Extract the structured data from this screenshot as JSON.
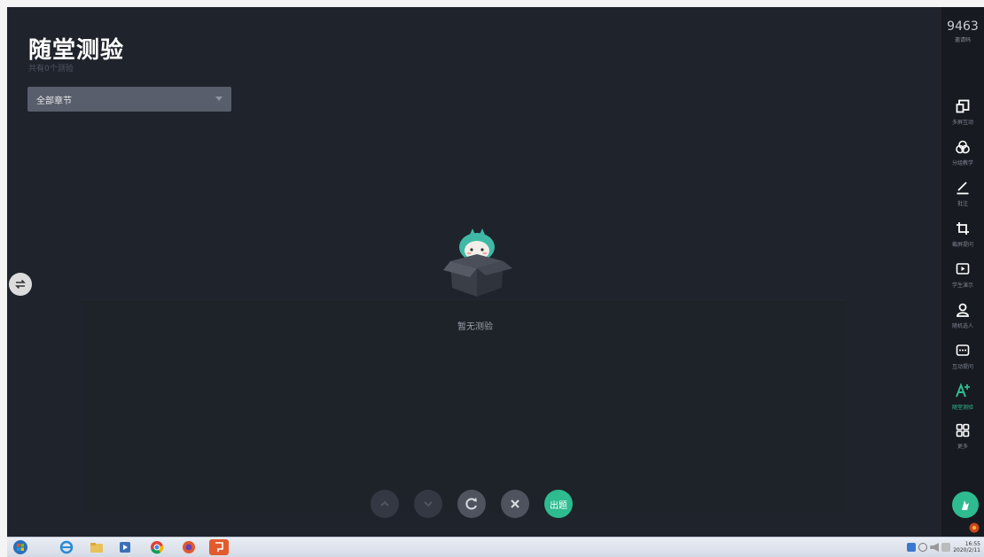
{
  "page": {
    "title": "随堂测验",
    "subtitle": "共有0个测验"
  },
  "chapter_select": {
    "value": "全部章节"
  },
  "empty_state": {
    "text": "暂无测验"
  },
  "bottom_controls": {
    "publish_label": "出题"
  },
  "right_bar": {
    "invite_code": "9463",
    "invite_label": "邀请码",
    "tools": [
      {
        "label": "多屏互动",
        "icon": "multi-screen-icon"
      },
      {
        "label": "分组教学",
        "icon": "group-teaching-icon"
      },
      {
        "label": "批注",
        "icon": "annotate-icon"
      },
      {
        "label": "截屏提问",
        "icon": "screenshot-crop-icon"
      },
      {
        "label": "学生演示",
        "icon": "student-present-icon"
      },
      {
        "label": "随机选人",
        "icon": "random-pick-icon"
      },
      {
        "label": "互动提问",
        "icon": "interactive-question-icon"
      },
      {
        "label": "随堂测验",
        "icon": "quiz-icon",
        "active": true
      },
      {
        "label": "更多",
        "icon": "more-grid-icon"
      }
    ]
  },
  "taskbar": {
    "time": "16:55",
    "date": "2020/2/11"
  },
  "colors": {
    "accent": "#2dbb8f",
    "background": "#1f232b",
    "sidebar": "#171a20"
  }
}
